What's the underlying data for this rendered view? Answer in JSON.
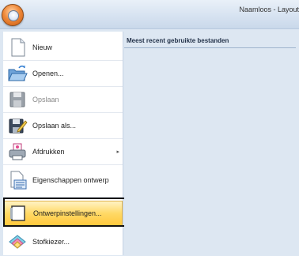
{
  "window": {
    "title": "Naamloos - Layout"
  },
  "app_button": {
    "icon": "application-orb-icon"
  },
  "menu": {
    "items": [
      {
        "label": "Nieuw",
        "icon": "new-document-icon",
        "disabled": false
      },
      {
        "label": "Openen...",
        "icon": "open-folder-icon",
        "disabled": false
      },
      {
        "label": "Opslaan",
        "icon": "save-disk-icon",
        "disabled": true
      },
      {
        "label": "Opslaan als...",
        "icon": "save-as-disk-icon",
        "disabled": false
      },
      {
        "label": "Afdrukken",
        "icon": "printer-icon",
        "disabled": false,
        "has_submenu": true
      },
      {
        "label": "Eigenschappen ontwerp",
        "icon": "design-properties-icon",
        "disabled": false
      },
      {
        "label": "Ontwerpinstellingen...",
        "icon": "design-settings-icon",
        "disabled": false,
        "highlighted": true
      },
      {
        "label": "Stofkiezer...",
        "icon": "fabric-selector-icon",
        "disabled": false
      }
    ],
    "submenu_arrow": "▸"
  },
  "recent_panel": {
    "title": "Meest recent gebruikte bestanden"
  }
}
